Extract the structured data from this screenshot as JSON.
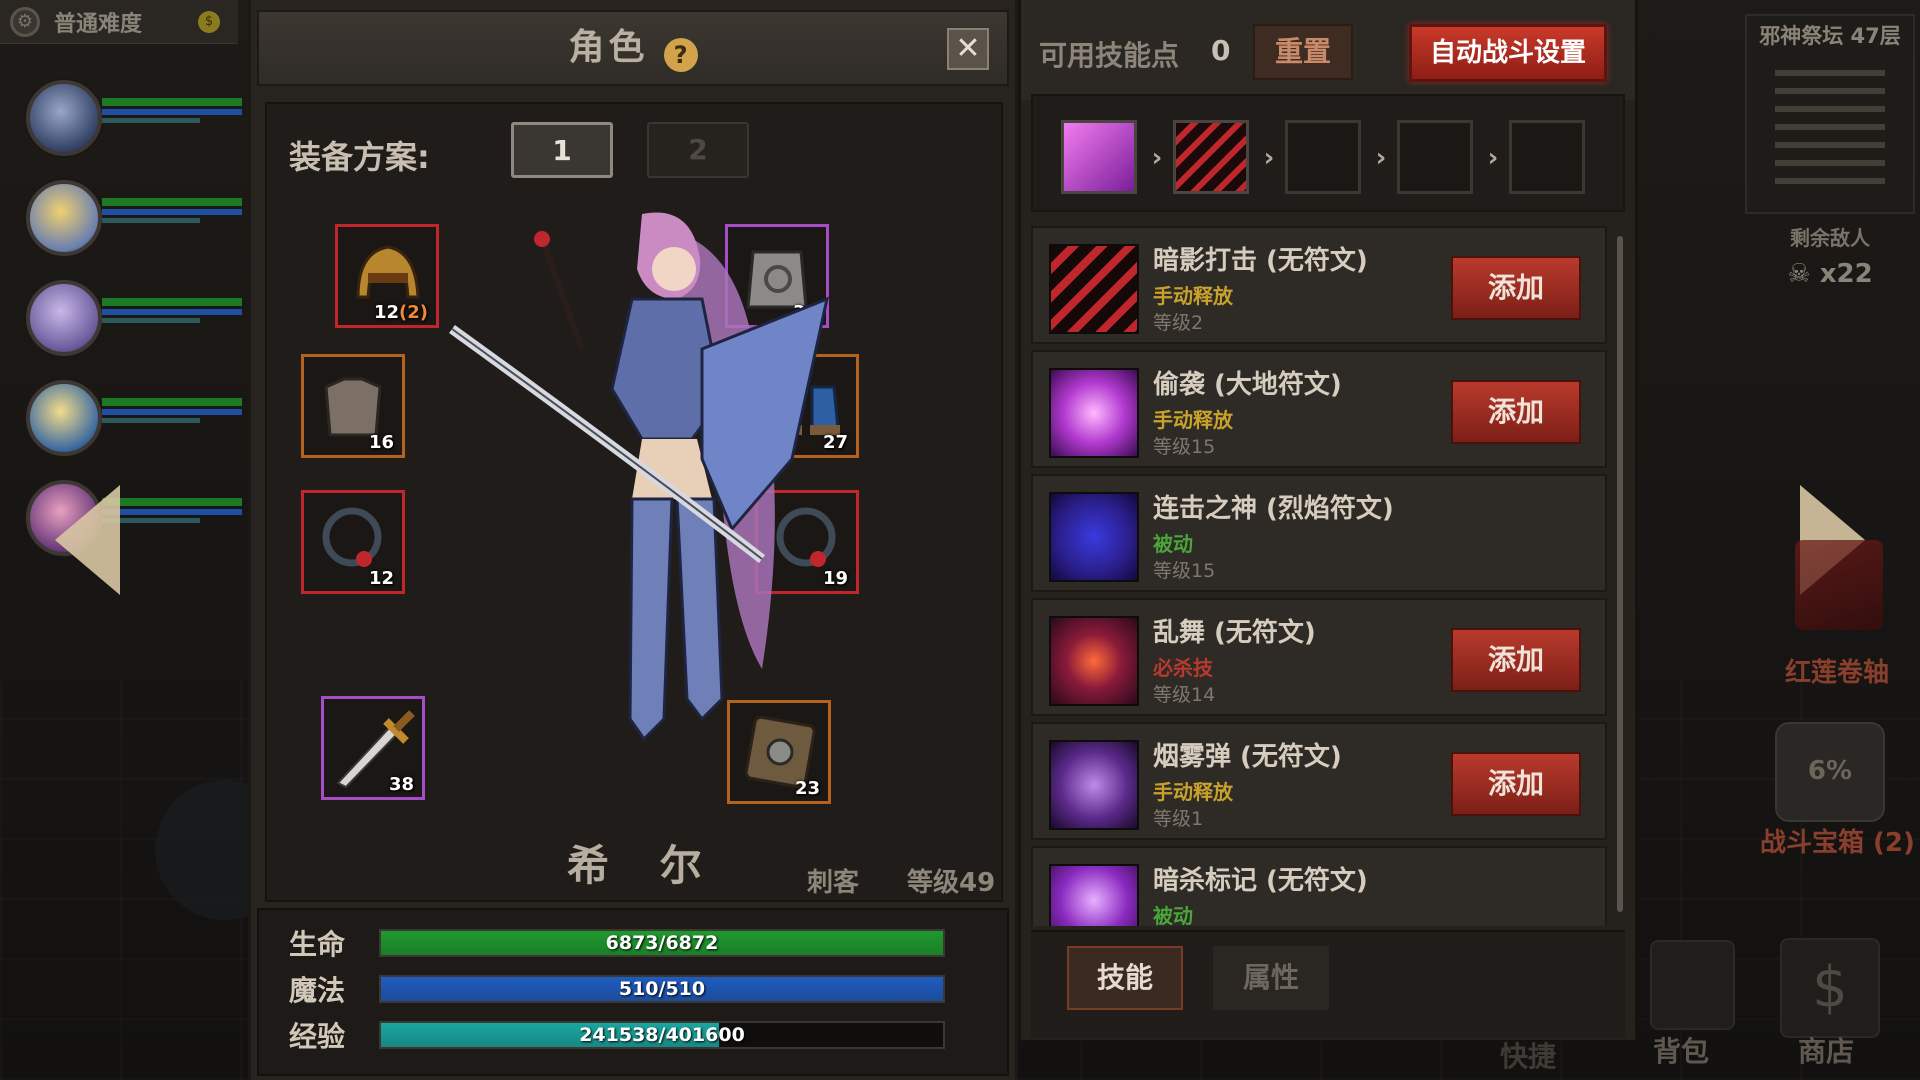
{
  "hud_left": {
    "difficulty": "普通难度",
    "coin_icon": "$"
  },
  "hud_right": {
    "dungeon": "邪神祭坛 47层",
    "enemies_title": "剩余敌人",
    "enemies_count": "x22",
    "scroll_label": "红莲卷轴",
    "chest_percent": "6%",
    "chest_label": "战斗宝箱 (2)",
    "bag_label": "背包",
    "shop_icon": "$",
    "shop_label": "商店",
    "faded_label": "快捷"
  },
  "character": {
    "title": "角色",
    "help_icon": "?",
    "close_icon": "✕",
    "loadout_label": "装备方案:",
    "loadout_options": [
      "1",
      "2"
    ],
    "name": "希 尔",
    "class": "刺客",
    "level": "等级49",
    "equipment": [
      {
        "slot": "helmet",
        "num": "12",
        "extra": "(2)",
        "rarity": "red"
      },
      {
        "slot": "cloak",
        "num": "31",
        "extra": "",
        "rarity": "purple"
      },
      {
        "slot": "armor",
        "num": "16",
        "extra": "",
        "rarity": "orange"
      },
      {
        "slot": "boots",
        "num": "27",
        "extra": "",
        "rarity": "orange"
      },
      {
        "slot": "ring-left",
        "num": "12",
        "extra": "",
        "rarity": "red"
      },
      {
        "slot": "ring-right",
        "num": "19",
        "extra": "",
        "rarity": "red"
      },
      {
        "slot": "weapon",
        "num": "38",
        "extra": "",
        "rarity": "purple"
      },
      {
        "slot": "shield",
        "num": "23",
        "extra": "",
        "rarity": "orange"
      }
    ],
    "stats": {
      "hp_label": "生命",
      "hp_text": "6873/6872",
      "hp_fill": 1.0,
      "mp_label": "魔法",
      "mp_text": "510/510",
      "mp_fill": 1.0,
      "xp_label": "经验",
      "xp_text": "241538/401600",
      "xp_fill": 0.6014
    }
  },
  "skills": {
    "points_label": "可用技能点",
    "points_value": "0",
    "reset_label": "重置",
    "auto_label": "自动战斗设置",
    "combo_arrow": "›",
    "list": [
      {
        "name": "暗影打击 (无符文)",
        "type": "手动释放",
        "type_class": "t-manual",
        "level": "等级2",
        "add": "添加",
        "icon": "shadow-strike-icon"
      },
      {
        "name": "偷袭 (大地符文)",
        "type": "手动释放",
        "type_class": "t-manual",
        "level": "等级15",
        "add": "添加",
        "icon": "sneak-attack-icon"
      },
      {
        "name": "连击之神 (烈焰符文)",
        "type": "被动",
        "type_class": "t-passive",
        "level": "等级15",
        "add": "",
        "icon": "combo-god-icon"
      },
      {
        "name": "乱舞 (无符文)",
        "type": "必杀技",
        "type_class": "t-ult",
        "level": "等级14",
        "add": "添加",
        "icon": "frenzy-icon"
      },
      {
        "name": "烟雾弹 (无符文)",
        "type": "手动释放",
        "type_class": "t-manual",
        "level": "等级1",
        "add": "添加",
        "icon": "smoke-bomb-icon"
      },
      {
        "name": "暗杀标记 (无符文)",
        "type": "被动",
        "type_class": "t-passive",
        "level": "",
        "add": "",
        "icon": "assassin-mark-icon"
      }
    ],
    "tabs": [
      "技能",
      "属性"
    ]
  },
  "colors": {
    "hp": "#1e9a2e",
    "mp": "#1f5cc0",
    "xp": "#1aa6a0",
    "accent_red": "#c93a2a"
  }
}
